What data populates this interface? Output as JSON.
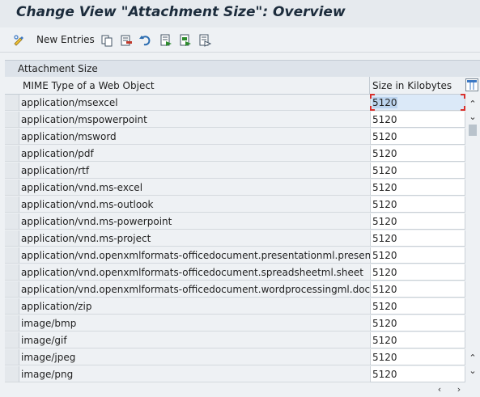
{
  "window": {
    "title": "Change View \"Attachment Size\": Overview"
  },
  "toolbar": {
    "items": [
      {
        "icon": "change-display-icon"
      },
      {
        "label": "New Entries",
        "icon": "new-entries-label"
      },
      {
        "icon": "copy-icon"
      },
      {
        "icon": "delete-icon"
      },
      {
        "icon": "undo-icon"
      },
      {
        "icon": "select-all-icon"
      },
      {
        "icon": "select-block-icon"
      },
      {
        "icon": "deselect-all-icon"
      }
    ]
  },
  "table": {
    "title": "Attachment Size",
    "columns": [
      "MIME Type of a Web Object",
      "Size in Kilobytes"
    ],
    "rows": [
      {
        "mime": "application/msexcel",
        "size": "5120"
      },
      {
        "mime": "application/mspowerpoint",
        "size": "5120"
      },
      {
        "mime": "application/msword",
        "size": "5120"
      },
      {
        "mime": "application/pdf",
        "size": "5120"
      },
      {
        "mime": "application/rtf",
        "size": "5120"
      },
      {
        "mime": "application/vnd.ms-excel",
        "size": "5120"
      },
      {
        "mime": "application/vnd.ms-outlook",
        "size": "5120"
      },
      {
        "mime": "application/vnd.ms-powerpoint",
        "size": "5120"
      },
      {
        "mime": "application/vnd.ms-project",
        "size": "5120"
      },
      {
        "mime": "application/vnd.openxmlformats-officedocument.presentationml.presentation",
        "size": "5120"
      },
      {
        "mime": "application/vnd.openxmlformats-officedocument.spreadsheetml.sheet",
        "size": "5120"
      },
      {
        "mime": "application/vnd.openxmlformats-officedocument.wordprocessingml.document",
        "size": "5120"
      },
      {
        "mime": "application/zip",
        "size": "5120"
      },
      {
        "mime": "image/bmp",
        "size": "5120"
      },
      {
        "mime": "image/gif",
        "size": "5120"
      },
      {
        "mime": "image/jpeg",
        "size": "5120"
      },
      {
        "mime": "image/png",
        "size": "5120"
      }
    ]
  },
  "colors": {
    "active_cell": "#dbe9f8",
    "focus_marker": "#d9302c"
  }
}
